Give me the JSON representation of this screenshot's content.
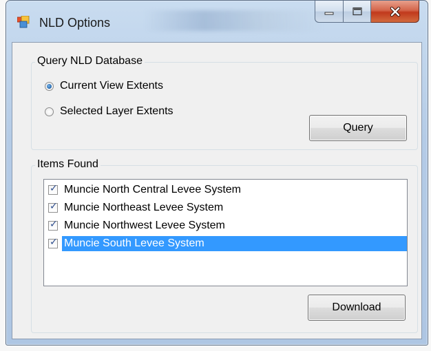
{
  "window": {
    "title": "NLD Options",
    "controls": {
      "minimize": "minimize-icon",
      "maximize": "maximize-icon",
      "close": "close-icon"
    }
  },
  "query_group": {
    "legend": "Query NLD Database",
    "options": [
      {
        "label": "Current View Extents",
        "checked": true
      },
      {
        "label": "Selected Layer Extents",
        "checked": false
      }
    ],
    "query_button": "Query"
  },
  "items_group": {
    "legend": "Items Found",
    "items": [
      {
        "label": "Muncie North Central Levee System",
        "checked": true,
        "selected": false
      },
      {
        "label": "Muncie Northeast Levee System",
        "checked": true,
        "selected": false
      },
      {
        "label": "Muncie Northwest Levee System",
        "checked": true,
        "selected": false
      },
      {
        "label": "Muncie South Levee System",
        "checked": true,
        "selected": true
      }
    ],
    "download_button": "Download"
  },
  "colors": {
    "selection": "#3399ff",
    "close_button": "#c1391c"
  }
}
